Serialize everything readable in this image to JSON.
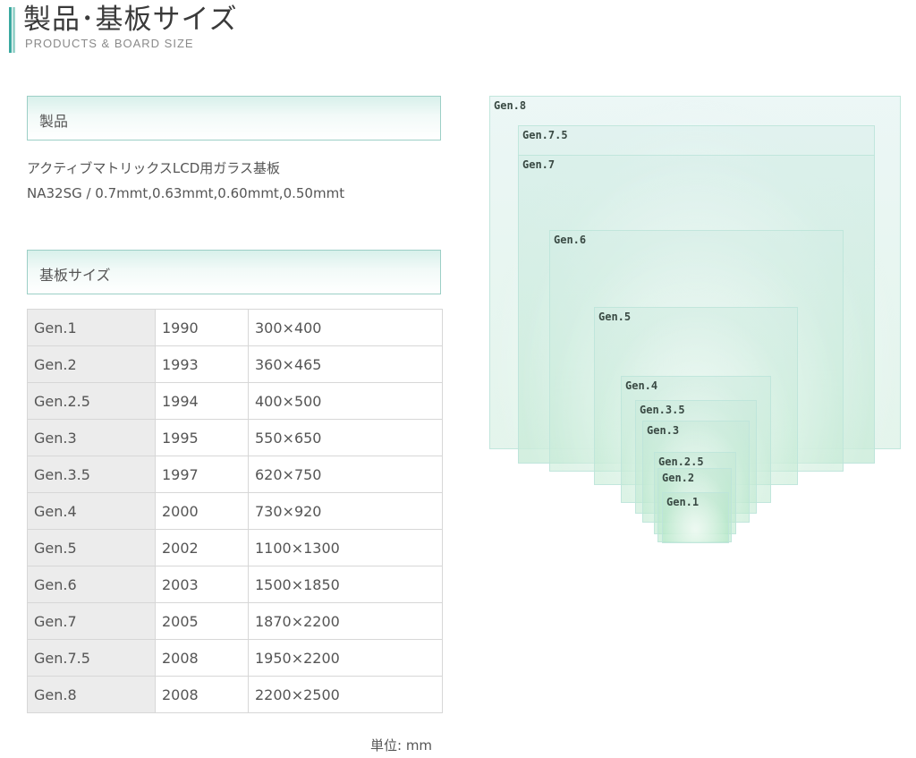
{
  "header": {
    "title": "製品･基板サイズ",
    "subtitle": "PRODUCTS & BOARD SIZE"
  },
  "products_section": {
    "heading": "製品",
    "line1": "アクティブマトリックスLCD用ガラス基板",
    "line2": "NA32SG / 0.7mmt,0.63mmt,0.60mmt,0.50mmt"
  },
  "sizes_section": {
    "heading": "基板サイズ",
    "rows": [
      {
        "gen": "Gen.1",
        "year": "1990",
        "size": "300×400"
      },
      {
        "gen": "Gen.2",
        "year": "1993",
        "size": "360×465"
      },
      {
        "gen": "Gen.2.5",
        "year": "1994",
        "size": "400×500"
      },
      {
        "gen": "Gen.3",
        "year": "1995",
        "size": "550×650"
      },
      {
        "gen": "Gen.3.5",
        "year": "1997",
        "size": "620×750"
      },
      {
        "gen": "Gen.4",
        "year": "2000",
        "size": "730×920"
      },
      {
        "gen": "Gen.5",
        "year": "2002",
        "size": "1100×1300"
      },
      {
        "gen": "Gen.6",
        "year": "2003",
        "size": "1500×1850"
      },
      {
        "gen": "Gen.7",
        "year": "2005",
        "size": "1870×2200"
      },
      {
        "gen": "Gen.7.5",
        "year": "2008",
        "size": "1950×2200"
      },
      {
        "gen": "Gen.8",
        "year": "2008",
        "size": "2200×2500"
      }
    ],
    "unit": "単位: mm"
  },
  "diagram": {
    "labels": [
      "Gen.8",
      "Gen.7.5",
      "Gen.7",
      "Gen.6",
      "Gen.5",
      "Gen.4",
      "Gen.3.5",
      "Gen.3",
      "Gen.2.5",
      "Gen.2",
      "Gen.1"
    ]
  }
}
